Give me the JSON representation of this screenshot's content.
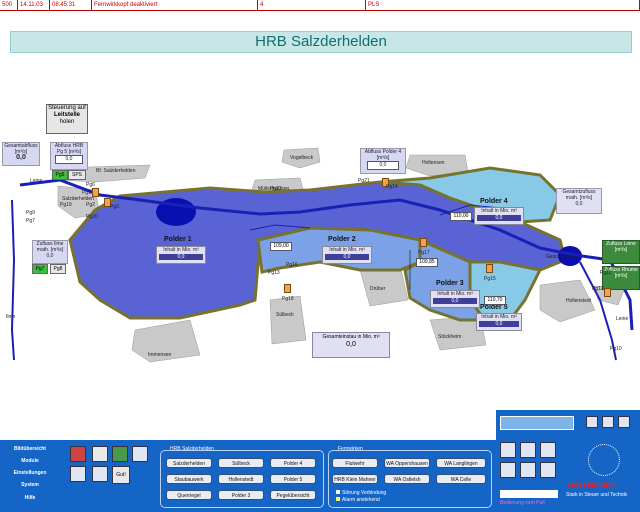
{
  "alarm": {
    "id": "500",
    "date": "14.11.03",
    "time": "08:45:31",
    "message": "Fernwirkkopf deaktiviert",
    "code": "4",
    "status": "PLS"
  },
  "title": "HRB Salzderhelden",
  "control": {
    "line1": "Steuerung auf",
    "line2": "Leitstelle",
    "line3": "holen"
  },
  "gesamtabfluss": {
    "label": "Gesamtabfluss [m³/s]",
    "value": "0,0"
  },
  "abfluss_hrb": {
    "label1": "Abfluss HRB",
    "label2": "Pg 5 [m³/s]",
    "value": "0,0",
    "btn_pg": "Pg5",
    "btn_sps": "SPS"
  },
  "abfluss_polder4": {
    "label1": "Abfluss Polder 4",
    "label2": "[m³/s]",
    "value": "0,0"
  },
  "zufluss_ilme": {
    "label1": "Zufluss Ilme",
    "label2": "math. [m³/s]",
    "value": "0,0",
    "btn1": "Pg7",
    "btn2": "Pg8"
  },
  "gesamtzufluss": {
    "label1": "Gesamtzufluss",
    "label2": "math. [m³/s]",
    "value": "0,0"
  },
  "zufluss_leine": {
    "label1": "Zufluss Leine",
    "label2": "[m³/s]"
  },
  "zufluss_rhume": {
    "label1": "Zufluss Rhume",
    "label2": "[m³/s]"
  },
  "gesamteinstau": {
    "label": "Gesamteinstau in Mio. m³",
    "value": "0,0"
  },
  "polders": [
    {
      "name": "Polder 1",
      "inhalt": "Inhalt in Mio. m³",
      "value": "0,0"
    },
    {
      "name": "Polder 2",
      "inhalt": "Inhalt in Mio. m³",
      "value": "0,0"
    },
    {
      "name": "Polder 3",
      "inhalt": "Inhalt in Mio. m³",
      "value": "0,0"
    },
    {
      "name": "Polder 4",
      "inhalt": "Inhalt in Mio. m³",
      "value": "0,0"
    },
    {
      "name": "Polder 5",
      "inhalt": "Inhalt in Mio. m³",
      "value": "0,0"
    }
  ],
  "places": {
    "vogelbeck": "Vogelbeck",
    "muellenhausen": "Müllenhausen",
    "holtensen": "Holtensen",
    "salzderhelden": "Salzderhelden",
    "bf_salzderhelden": "Bf. Salzderhelden",
    "immensen": "Immensen",
    "sulbeck": "Sülbeck",
    "drueber": "Drüber",
    "stoeckheim": "Stöckheim",
    "hollenstedt": "Hollenstedt",
    "leine_top": "Leine",
    "ilme": "Ilme",
    "leine_bottom": "Leine",
    "geschiebefang": "Geschiebefang"
  },
  "gauges": {
    "pg6": "Pg6",
    "pg9": "Pg9",
    "pg22": "Pg22",
    "pg21": "Pg21",
    "pg14": "Pg14",
    "pg19": "Pg19",
    "pg20": "Pg20",
    "pg17": "Pg17",
    "pg16": "Pg16",
    "pg18": "Pg18",
    "pg11": "Pg11",
    "pg12": "Pg12",
    "pg13": "Pg13",
    "pg10": "Pg10",
    "pg1": "Pg1",
    "pg2": "Pg2",
    "pg3": "Pg3",
    "pg4": "Pg4",
    "pg5": "Pg5",
    "pg7": "Pg7",
    "pg8": "Pg8",
    "pg15": "Pg15"
  },
  "levels": {
    "l1": "109,00",
    "l2": "110,00",
    "l3": "109,85",
    "l4": "110,70"
  },
  "nav": {
    "bilduebersicht": "Bildübersicht",
    "module": "Module",
    "einstellungen": "Einstellungen",
    "system": "System",
    "hilfe": "Hilfe",
    "gut": "Gut!"
  },
  "group_hrb": {
    "title": "HRB Salzderhelden",
    "buttons": [
      "Salzderhelden",
      "Sülbeck",
      "Polder 4",
      "Staubauwerk",
      "Hollenstedt",
      "Polder 5",
      "Querriegel",
      "Polder 3",
      "Pegelübersicht"
    ]
  },
  "group_fw": {
    "title": "Fernwirken",
    "buttons": [
      "Flutwehr",
      "WA Oppershausen",
      "WA Langlingen",
      "HRB Klein Mahner",
      "WA Ostlelsh",
      "WA Celle"
    ],
    "legend1": "Störung Verbindung",
    "legend2": "Alarm anstehend"
  },
  "brand": {
    "name": "Hasselmann",
    "tagline": "Stark in Steuer und Technik",
    "product": "EnerCoS 3.0",
    "status": "Bedienung vom Pult"
  },
  "colors": {
    "water": "#5a63d3",
    "polder_light": "#7ba2e6",
    "river": "#1a20b5",
    "dike": "#77722d"
  }
}
